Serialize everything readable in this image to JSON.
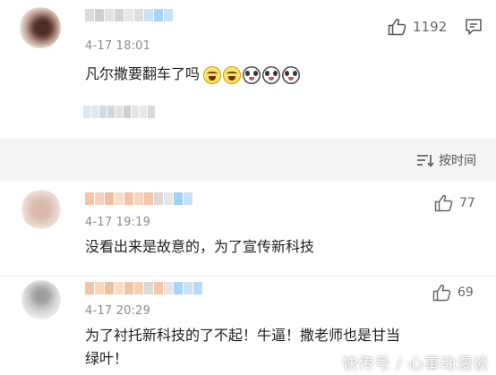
{
  "pinned_comment": {
    "time": "4-17 18:01",
    "text": "凡尔撒要翻车了吗",
    "likes": "1192",
    "emojis": [
      "laugh-cry-emoji",
      "laugh-cry-emoji",
      "panda-emoji",
      "panda-emoji",
      "panda-emoji"
    ]
  },
  "sort": {
    "label": "按时间"
  },
  "comments": [
    {
      "time": "4-17 19:19",
      "text": "没看出来是故意的，为了宣传新科技",
      "likes": "77"
    },
    {
      "time": "4-17 20:29",
      "text_line1": "为了衬托新科技的了不起！牛逼！撒老师也是甘当",
      "text_line2": "绿叶！",
      "likes": "69"
    }
  ],
  "watermark": "快传号 / 心事动漫谈",
  "colors": {
    "accent_blue": "#a8d4f6",
    "accent_orange": "#f6c9a3",
    "sort_bar_bg": "#f4f4f4",
    "time_gray": "#8c8c8c"
  }
}
